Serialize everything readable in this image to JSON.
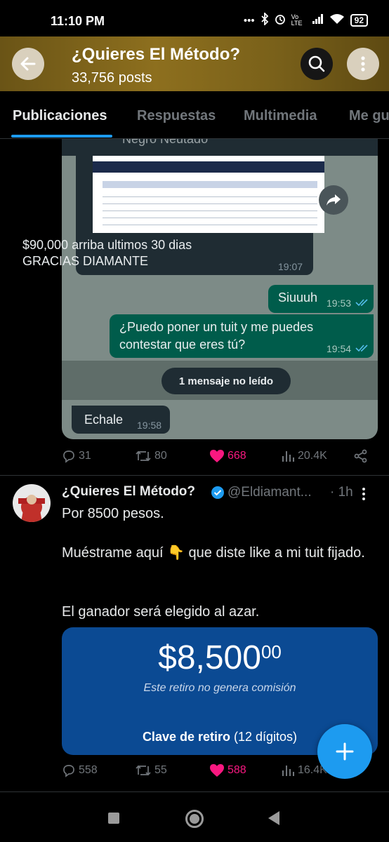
{
  "status_bar": {
    "time": "11:10 PM",
    "network": "Vo LTE",
    "battery": "92"
  },
  "header": {
    "title": "¿Quieres El Método?",
    "subtitle": "33,756 posts"
  },
  "tabs": [
    {
      "label": "Publicaciones"
    },
    {
      "label": "Respuestas"
    },
    {
      "label": "Multimedia"
    },
    {
      "label": "Me gu"
    }
  ],
  "tweet1": {
    "chat": {
      "contact": "Negro Neutado",
      "msg1_text": "$90,000 arriba ultimos 30 dias GRACIAS DIAMANTE",
      "msg1_time": "19:07",
      "msg2_text": "Siuuuh",
      "msg2_time": "19:53",
      "msg3_text": "¿Puedo poner un tuit y me puedes contestar que eres tú?",
      "msg3_time": "19:54",
      "unread": "1 mensaje no leído",
      "msg4_text": "Echale",
      "msg4_time": "19:58"
    },
    "stats": {
      "replies": "31",
      "retweets": "80",
      "likes": "668",
      "views": "20.4K"
    }
  },
  "tweet2": {
    "name": "¿Quieres El Método?",
    "handle": "@Eldiamant...",
    "time": "· 1h",
    "line1": "Por 8500 pesos.",
    "line2": "Muéstrame aquí 👇 que diste like a mi tuit fijado.",
    "line3": "El ganador será elegido al azar.",
    "card": {
      "amount": "$8,500",
      "cents": "00",
      "note": "Este retiro no genera comisión",
      "clave_bold": "Clave de retiro",
      "clave_rest": " (12 dígitos)"
    },
    "stats": {
      "replies": "558",
      "retweets": "55",
      "likes": "588",
      "views": "16.4K"
    }
  },
  "colors": {
    "accent": "#1d9bf0",
    "like": "#f91880",
    "whatsapp_out": "#005c4b",
    "card_bg": "#0b4a93"
  }
}
